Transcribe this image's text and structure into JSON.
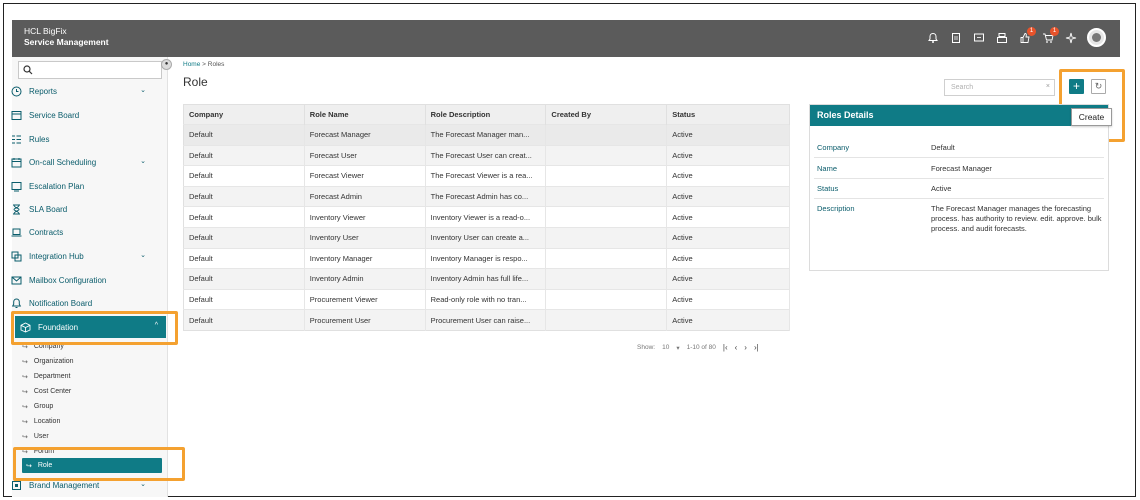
{
  "header": {
    "brand_line1": "HCL BigFix",
    "brand_line2": "Service Management",
    "notifications_badge": "1",
    "cart_badge": "1"
  },
  "sidebar": {
    "items": [
      {
        "label": "Reports",
        "icon": "clock-icon",
        "expandable": true
      },
      {
        "label": "Service Board",
        "icon": "board-icon",
        "expandable": false
      },
      {
        "label": "Rules",
        "icon": "rules-icon",
        "expandable": false
      },
      {
        "label": "On-call Scheduling",
        "icon": "calendar-icon",
        "expandable": true
      },
      {
        "label": "Escalation Plan",
        "icon": "monitor-icon",
        "expandable": false
      },
      {
        "label": "SLA Board",
        "icon": "hourglass-icon",
        "expandable": false
      },
      {
        "label": "Contracts",
        "icon": "laptop-icon",
        "expandable": false
      },
      {
        "label": "Integration Hub",
        "icon": "hub-icon",
        "expandable": true
      },
      {
        "label": "Mailbox Configuration",
        "icon": "mail-icon",
        "expandable": false
      },
      {
        "label": "Notification Board",
        "icon": "bell-icon",
        "expandable": false
      },
      {
        "label": "Foundation",
        "icon": "cube-icon",
        "expandable": true,
        "active": true
      }
    ],
    "sub_items": [
      "Company",
      "Organization",
      "Department",
      "Cost Center",
      "Group",
      "Location",
      "User",
      "Forum",
      "Role"
    ],
    "bottom_item": "Brand Management"
  },
  "breadcrumb": {
    "home": "Home",
    "separator": ">",
    "current": "Roles"
  },
  "page_title": "Role",
  "search_placeholder": "Search",
  "tooltip": "Create",
  "table": {
    "headers": [
      "Company",
      "Role Name",
      "Role Description",
      "Created By",
      "Status"
    ],
    "rows": [
      [
        "Default",
        "Forecast Manager",
        "The Forecast Manager man...",
        "",
        "Active"
      ],
      [
        "Default",
        "Forecast User",
        "The Forecast User can creat...",
        "",
        "Active"
      ],
      [
        "Default",
        "Forecast Viewer",
        "The Forecast Viewer is a rea...",
        "",
        "Active"
      ],
      [
        "Default",
        "Forecast Admin",
        "The Forecast Admin has co...",
        "",
        "Active"
      ],
      [
        "Default",
        "Inventory Viewer",
        "Inventory Viewer is a read-o...",
        "",
        "Active"
      ],
      [
        "Default",
        "Inventory User",
        "Inventory User can create a...",
        "",
        "Active"
      ],
      [
        "Default",
        "Inventory Manager",
        "Inventory Manager is respo...",
        "",
        "Active"
      ],
      [
        "Default",
        "Inventory Admin",
        "Inventory Admin has full life...",
        "",
        "Active"
      ],
      [
        "Default",
        "Procurement Viewer",
        "Read-only role with no tran...",
        "",
        "Active"
      ],
      [
        "Default",
        "Procurement User",
        "Procurement User can raise...",
        "",
        "Active"
      ]
    ]
  },
  "pager": {
    "show_label": "Show:",
    "page_size": "10",
    "range": "1-10 of 80"
  },
  "details": {
    "title": "Roles Details",
    "fields": [
      {
        "key": "Company",
        "value": "Default"
      },
      {
        "key": "Name",
        "value": "Forecast Manager"
      },
      {
        "key": "Status",
        "value": "Active"
      },
      {
        "key": "Description",
        "value": "The Forecast Manager manages the forecasting process. has authority to review. edit. approve. bulk process. and audit forecasts."
      }
    ]
  },
  "colors": {
    "accent": "#0f7b86",
    "highlight": "#f4a130",
    "topbar": "#5b5b5b"
  }
}
